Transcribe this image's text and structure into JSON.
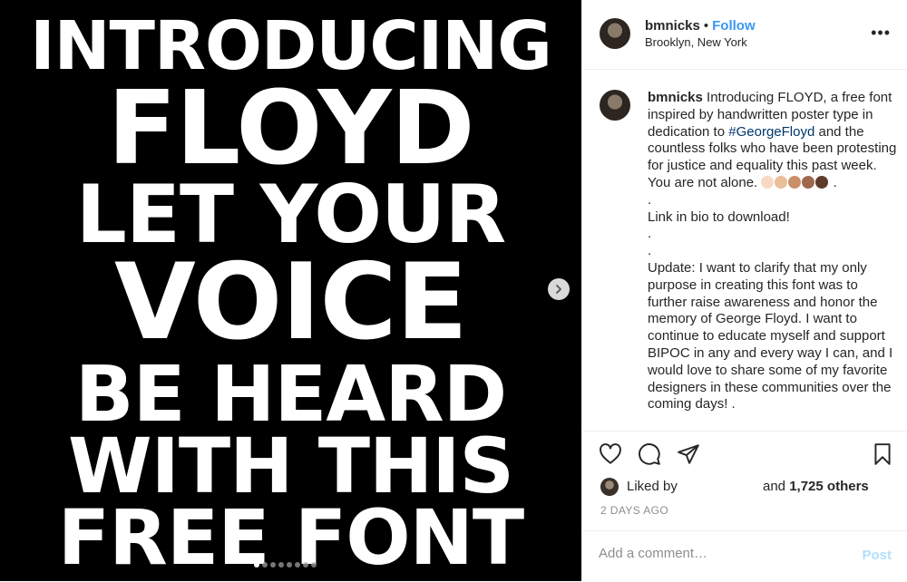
{
  "poster": {
    "lines": [
      "INTRODUCING",
      "FLOYD",
      "LET YOUR",
      "VOICE",
      "BE HEARD",
      "WITH THIS",
      "FREE FONT"
    ]
  },
  "header": {
    "username": "bmnicks",
    "separator": "•",
    "follow": "Follow",
    "location": "Brooklyn, New York"
  },
  "caption": {
    "username": "bmnicks",
    "text_before_tag": "Introducing FLOYD, a free font inspired by handwritten poster type in dedication to",
    "hashtag": "#GeorgeFloyd",
    "text_after_tag": "and the countless folks who have been protesting for justice and equality this past week. You are not alone.",
    "emoji_end": ".",
    "dot1": ".",
    "link_line": "Link in bio to download!",
    "dot2": ".",
    "dot3": ".",
    "update": "Update: I want to clarify that my only purpose in creating this font was to further raise awareness and honor the memory of George Floyd. I want to continue to educate myself and support BIPOC in any and every way I can, and I would love to share some of my favorite designers in these communities over the coming days! ."
  },
  "emoji_colors": [
    "#f7d9c4",
    "#e9bf99",
    "#c8906a",
    "#a0684a",
    "#5e3c2c"
  ],
  "likes": {
    "liked_by": "Liked by",
    "and_label": "and",
    "count": "1,725 others"
  },
  "timestamp": "2 DAYS AGO",
  "comment": {
    "placeholder": "Add a comment…",
    "post": "Post"
  },
  "carousel": {
    "total": 8,
    "active": 1
  },
  "icons": {
    "like": "heart-icon",
    "comment": "comment-bubble-icon",
    "share": "paper-plane-icon",
    "save": "bookmark-icon",
    "next": "chevron-right-icon",
    "more": "more-options-icon"
  }
}
